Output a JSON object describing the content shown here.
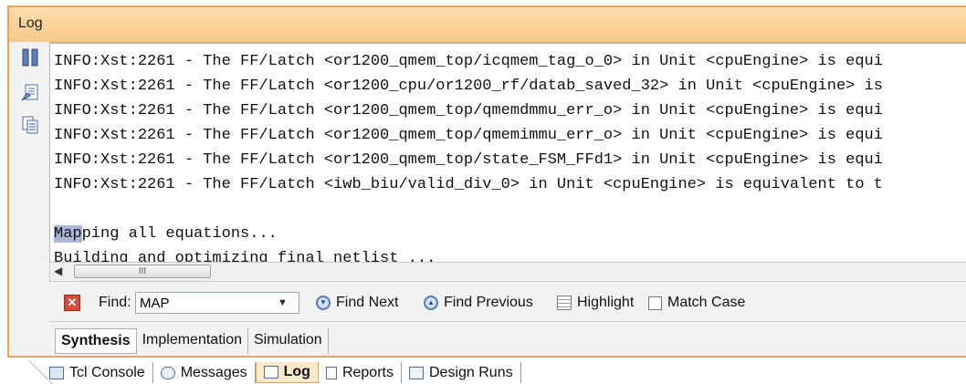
{
  "panel": {
    "title": "Log"
  },
  "side_icons": [
    "pause-icon",
    "clear-log-icon",
    "copy-icon"
  ],
  "log": {
    "lines": [
      "INFO:Xst:2261 - The FF/Latch <or1200_qmem_top/icqmem_tag_o_0> in Unit <cpuEngine> is equi",
      "INFO:Xst:2261 - The FF/Latch <or1200_cpu/or1200_rf/datab_saved_32> in Unit <cpuEngine> is",
      "INFO:Xst:2261 - The FF/Latch <or1200_qmem_top/qmemdmmu_err_o> in Unit <cpuEngine> is equi",
      "INFO:Xst:2261 - The FF/Latch <or1200_qmem_top/qmemimmu_err_o> in Unit <cpuEngine> is equi",
      "INFO:Xst:2261 - The FF/Latch <or1200_qmem_top/state_FSM_FFd1> in Unit <cpuEngine> is equi",
      "INFO:Xst:2261 - The FF/Latch <iwb_biu/valid_div_0> in Unit <cpuEngine> is equivalent to t",
      "",
      "Mapping all equations...",
      "Building and optimizing final netlist ..."
    ],
    "highlight_prefix": "Map",
    "highlight_rest": "ping all equations..."
  },
  "scroll": {
    "left_arrow": "◀",
    "thumb_grip": "III"
  },
  "find": {
    "label": "Find:",
    "value": "MAP",
    "find_next": "Find Next",
    "find_previous": "Find Previous",
    "highlight": "Highlight",
    "match_case": "Match Case"
  },
  "inner_tabs": [
    "Synthesis",
    "Implementation",
    "Simulation"
  ],
  "bottom_tabs": [
    "Tcl Console",
    "Messages",
    "Log",
    "Reports",
    "Design Runs"
  ]
}
